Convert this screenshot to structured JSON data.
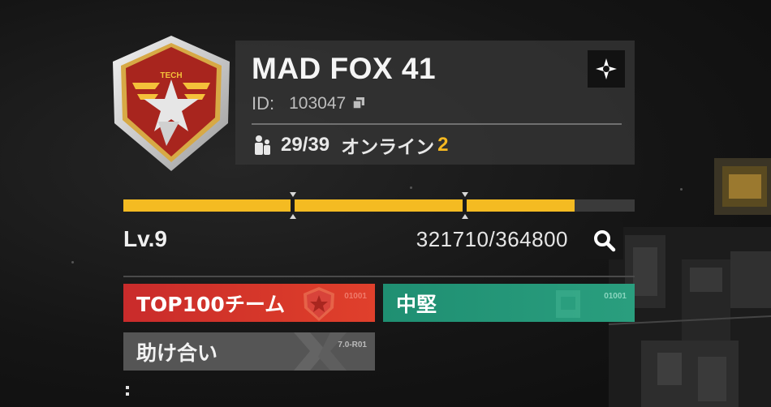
{
  "profile": {
    "name": "MAD FOX 41",
    "emblem_text": "TECH",
    "id_label": "ID:",
    "id_value": "103047",
    "members": "29/39",
    "online_label": "オンライン",
    "online_count": "2"
  },
  "level": {
    "label": "Lv.9",
    "xp_text": "321710/364800",
    "xp_current": 321710,
    "xp_max": 364800
  },
  "tags": [
    {
      "label": "TOP100チーム",
      "code": "01001",
      "color": "#c92b2b"
    },
    {
      "label": "中堅",
      "code": "01001",
      "color": "#1f8f72"
    },
    {
      "label": "助け合い",
      "code": "7.0-R01",
      "color": "#555555"
    }
  ],
  "colors": {
    "accent": "#f4bb22",
    "online": "#f5b820"
  },
  "icons": {
    "members": "members-icon",
    "copy": "copy-icon",
    "settings": "crosshair-icon",
    "search": "search-icon"
  }
}
